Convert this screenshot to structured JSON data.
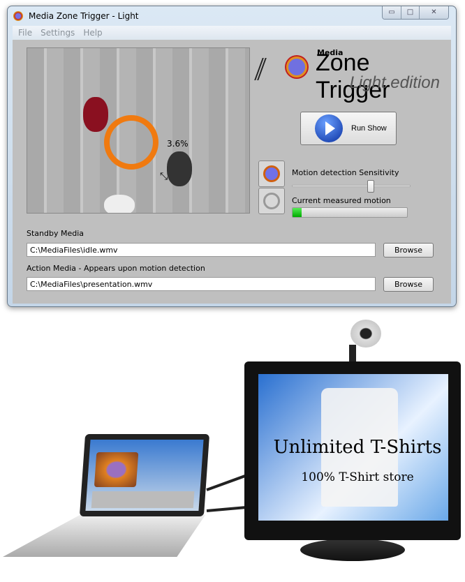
{
  "window": {
    "title": "Media Zone Trigger - Light",
    "controls": [
      "minimize",
      "maximize",
      "close"
    ]
  },
  "menu": [
    "File",
    "Settings",
    "Help"
  ],
  "video": {
    "motion_percent": "3.6%"
  },
  "logo": {
    "media": "Media",
    "name": "Zone Trigger",
    "edition": "Light edition"
  },
  "run_button": {
    "label": "Run Show",
    "icon": "play-icon"
  },
  "sensitivity": {
    "label": "Motion detection Sensitivity",
    "value_percent": 67
  },
  "motion": {
    "label": "Current measured motion",
    "value_percent": 8
  },
  "standby": {
    "label": "Standby Media",
    "value": "C:\\MediaFiles\\idle.wmv",
    "browse": "Browse"
  },
  "action": {
    "label": "Action Media - Appears upon motion detection",
    "value": "C:\\MediaFiles\\presentation.wmv",
    "browse": "Browse"
  },
  "monitor": {
    "headline": "Unlimited T-Shirts",
    "subline": "100% T-Shirt store"
  },
  "colors": {
    "ring": "#f07a10",
    "progress": "#22cc22",
    "accent": "#0a30a0"
  }
}
